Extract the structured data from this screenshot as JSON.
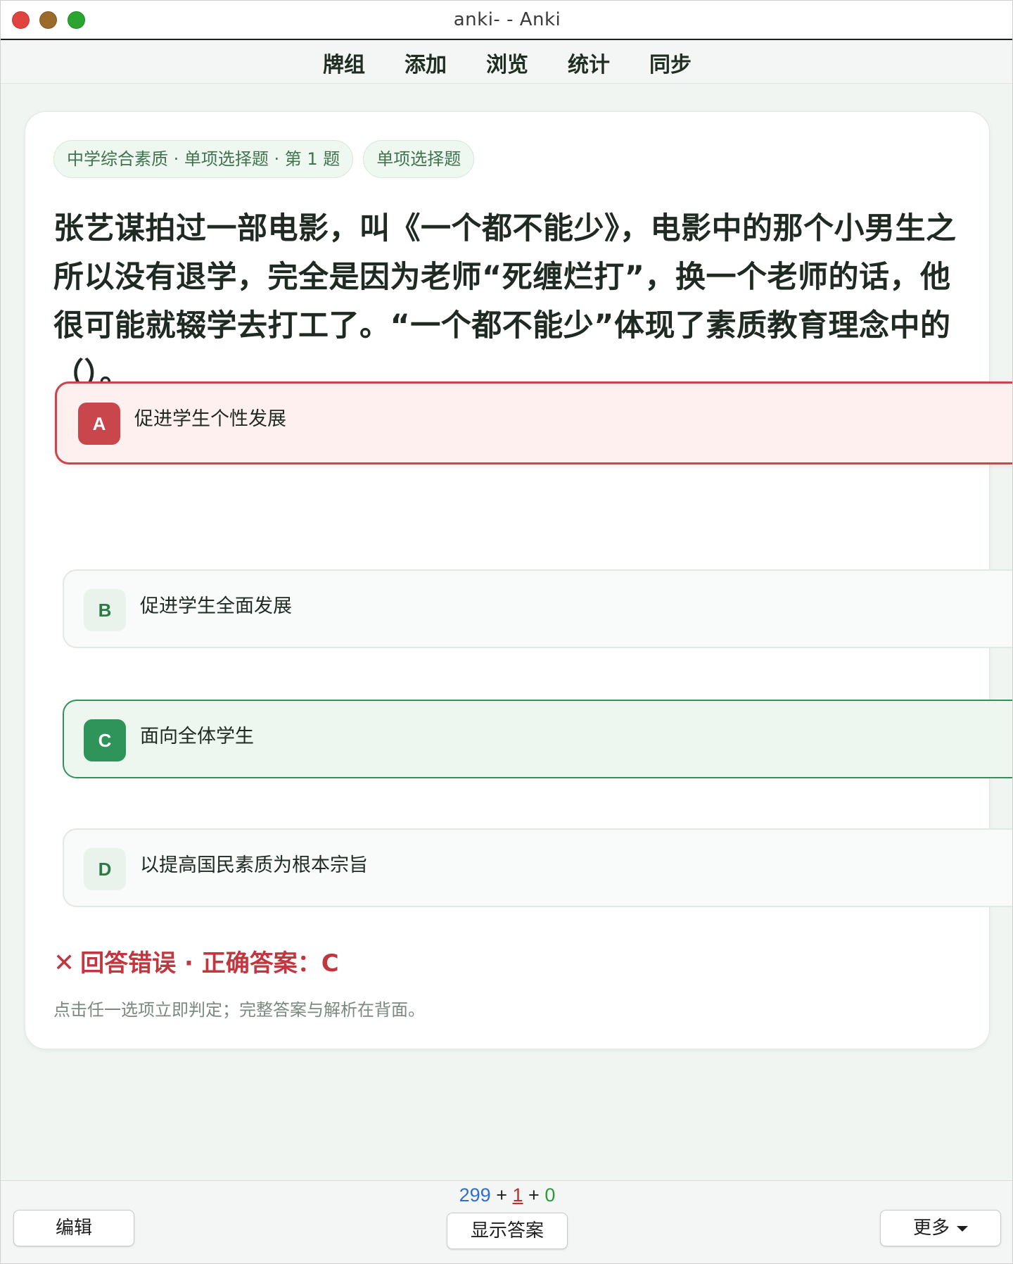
{
  "window": {
    "title": "anki- - Anki"
  },
  "toolbar": {
    "items": [
      "牌组",
      "添加",
      "浏览",
      "统计",
      "同步"
    ]
  },
  "card": {
    "chips": [
      "中学综合素质 · 单项选择题 · 第 1 题",
      "单项选择题"
    ],
    "question": "张艺谋拍过一部电影，叫《一个都不能少》，电影中的那个小男生之所以没有退学，完全是因为老师“死缠烂打”，换一个老师的话，他很可能就辍学去打工了。“一个都不能少”体现了素质教育理念中的（）。",
    "options": [
      {
        "letter": "A",
        "text": "促进学生个性发展",
        "state": "wrong"
      },
      {
        "letter": "B",
        "text": "促进学生全面发展",
        "state": "normal"
      },
      {
        "letter": "C",
        "text": "面向全体学生",
        "state": "correct"
      },
      {
        "letter": "D",
        "text": "以提高国民素质为根本宗旨",
        "state": "normal"
      }
    ],
    "result": "回答错误 · 正确答案：C",
    "hint": "点击任一选项立即判定；完整答案与解析在背面。"
  },
  "bottom": {
    "edit_label": "编辑",
    "show_answer_label": "显示答案",
    "more_label": "更多",
    "counts": {
      "new": "299",
      "learn": "1",
      "review": "0",
      "sep": "+"
    }
  },
  "colors": {
    "accent_green": "#2e9459",
    "error_red": "#c9464d",
    "new_blue": "#2f6fd1",
    "learn_red": "#c72a2a",
    "review_green": "#2a9a3a"
  },
  "icons": {
    "close": "close-window-icon",
    "minimize": "minimize-window-icon",
    "zoom": "zoom-window-icon",
    "result": "cross-icon",
    "more": "caret-down-icon"
  }
}
